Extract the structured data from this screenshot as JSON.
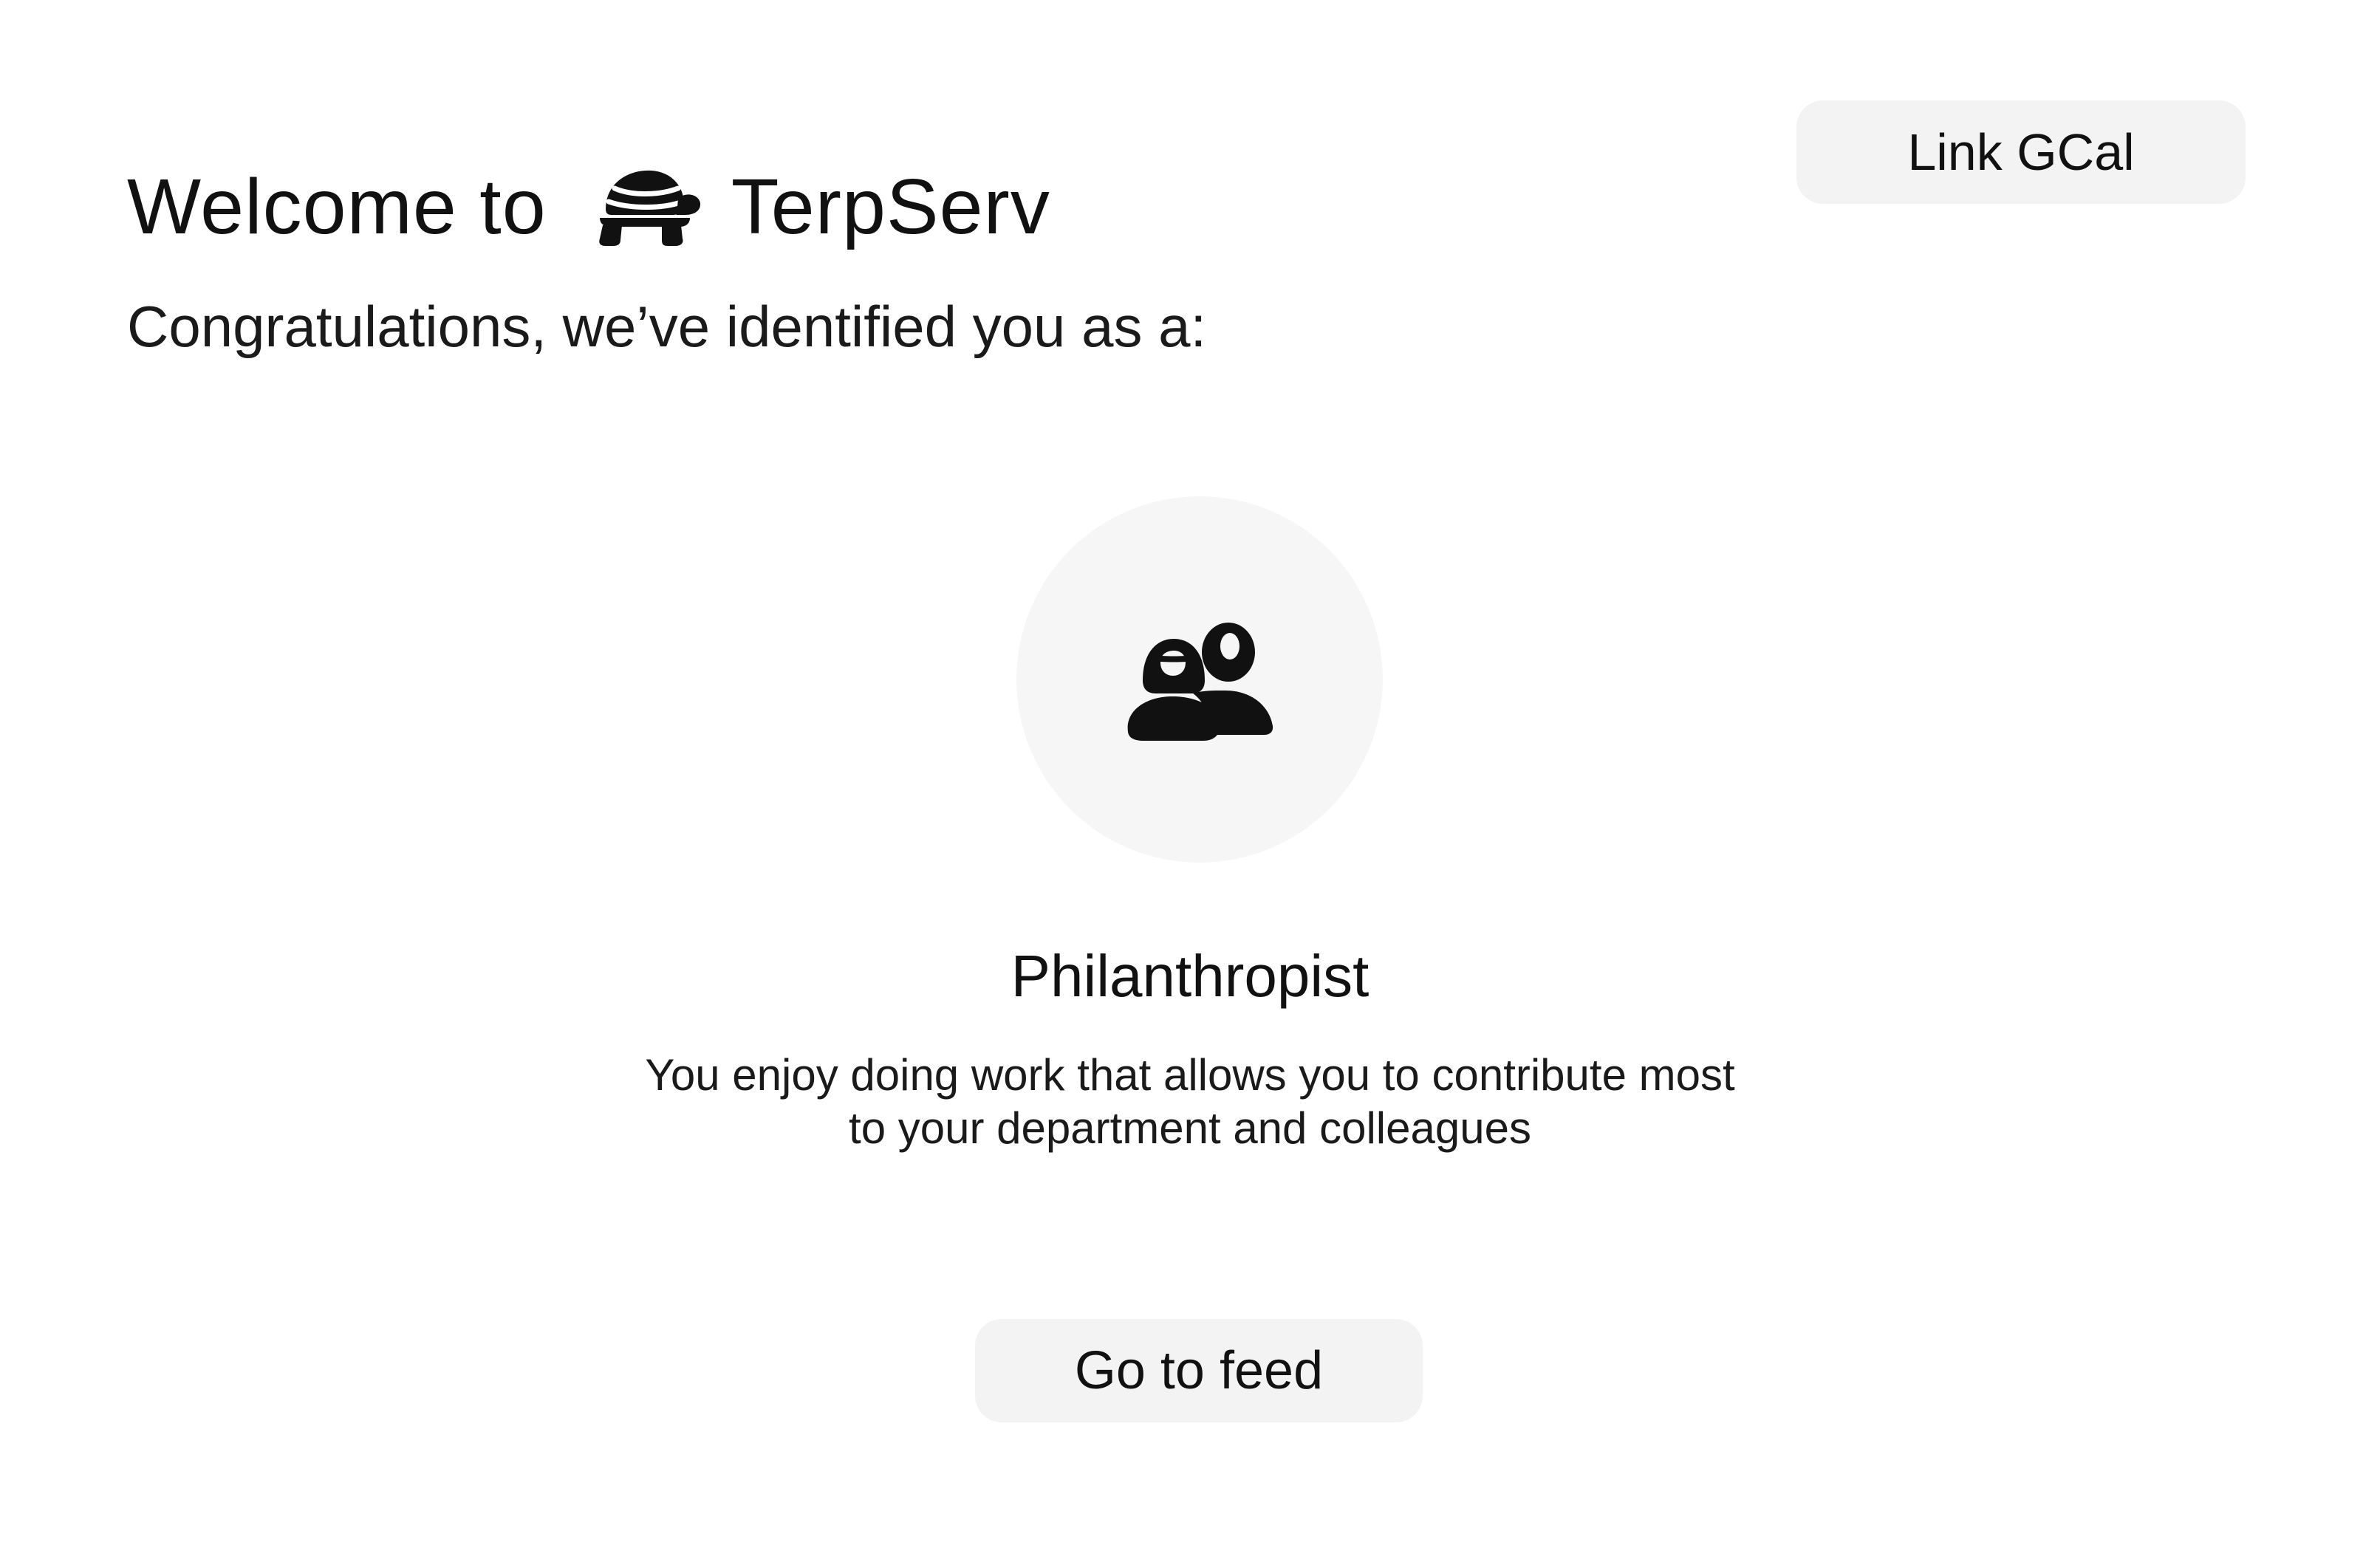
{
  "header": {
    "welcome_text": "Welcome to",
    "logo_icon": "turtle-icon",
    "app_name": "TerpServ"
  },
  "subtitle": "Congratulations, we’ve identified you as a:",
  "actions": {
    "link_gcal_label": "Link GCal",
    "go_to_feed_label": "Go to feed"
  },
  "persona": {
    "icon": "people-icon",
    "title": "Philanthropist",
    "description_line1": "You enjoy doing work that allows you to contribute most",
    "description_line2": "to your department and colleagues"
  },
  "colors": {
    "background": "#ffffff",
    "button_background": "#f3f3f3",
    "avatar_background": "#f6f6f6",
    "text": "#111111"
  }
}
